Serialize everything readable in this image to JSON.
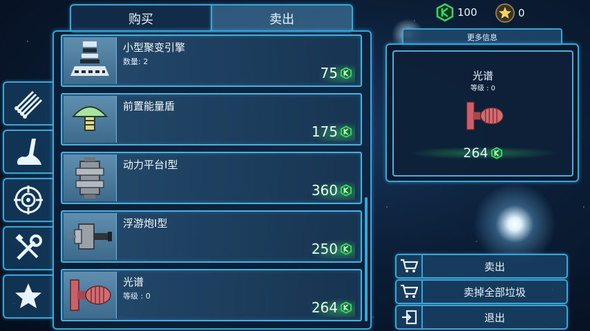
{
  "tabs": {
    "buy": "购买",
    "sell": "卖出"
  },
  "currency": {
    "gems": "100",
    "stars": "0"
  },
  "side_categories": [
    "pipes-icon",
    "hook-icon",
    "target-icon",
    "tools-icon",
    "star-icon"
  ],
  "items": [
    {
      "name": "小型聚变引擎",
      "sub": "数量: 2",
      "price": "75",
      "icon": "engine-icon"
    },
    {
      "name": "前置能量盾",
      "sub": "",
      "price": "175",
      "icon": "shield-icon"
    },
    {
      "name": "动力平台I型",
      "sub": "",
      "price": "360",
      "icon": "platform-icon"
    },
    {
      "name": "浮游炮I型",
      "sub": "",
      "price": "250",
      "icon": "cannon-icon"
    },
    {
      "name": "光谱",
      "sub": "等级 : 0",
      "price": "264",
      "icon": "spectrum-icon"
    }
  ],
  "info": {
    "header": "更多信息",
    "name": "光谱",
    "level": "等级 : 0",
    "price": "264"
  },
  "actions": {
    "sell": "卖出",
    "sell_junk": "卖掉全部垃圾",
    "exit": "退出"
  },
  "colors": {
    "accent": "#3aa6d8",
    "price_green": "#3ed26a"
  }
}
